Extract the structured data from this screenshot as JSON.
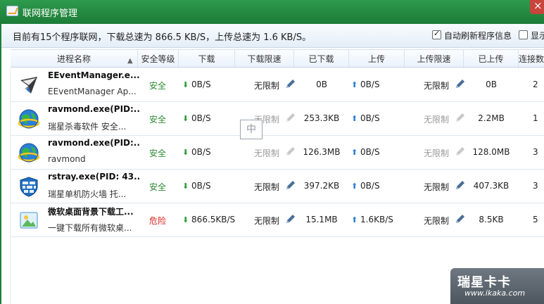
{
  "window": {
    "title": "联网程序管理"
  },
  "summary": {
    "text": "目前有15个程序联网，下载总速为  866.5 KB/S，上传总速为  1.6 KB/S。",
    "auto_refresh_label": "自动刷新程序信息",
    "auto_refresh_checked": true,
    "show_label": "显示",
    "show_checked": false
  },
  "columns": [
    "进程名称",
    "安全等级",
    "下载",
    "下载限速",
    "已下载",
    "上传",
    "上传限速",
    "已上传",
    "连接数"
  ],
  "rows": [
    {
      "icon": "eeventmanager-icon",
      "name": "EEventManager.e...",
      "desc": "EEventManager Ap...",
      "safety": "安全",
      "safety_level": "safe",
      "down": "0B/S",
      "down_limit": "无限制",
      "downloaded": "0B",
      "up": "0B/S",
      "up_limit": "无限制",
      "uploaded": "0B",
      "connections": "2"
    },
    {
      "icon": "ravmond-globe-icon",
      "name": "ravmond.exe(PID:...",
      "desc": "瑞星杀毒软件 安全...",
      "safety": "安全",
      "safety_level": "safe",
      "down": "0B/S",
      "down_limit": "无限制",
      "downloaded": "253.3KB",
      "up": "0B/S",
      "up_limit": "无限制",
      "uploaded": "2.2MB",
      "connections": "1"
    },
    {
      "icon": "ravmond-globe-icon",
      "name": "ravmond.exe(PID:...",
      "desc": "ravmond",
      "safety": "安全",
      "safety_level": "safe",
      "down": "0B/S",
      "down_limit": "无限制",
      "downloaded": "126.3MB",
      "up": "0B/S",
      "up_limit": "无限制",
      "uploaded": "128.0MB",
      "connections": "3"
    },
    {
      "icon": "firewall-shield-icon",
      "name": "rstray.exe(PID: 43...",
      "desc": "瑞星单机防火墙 托...",
      "safety": "安全",
      "safety_level": "safe",
      "down": "0B/S",
      "down_limit": "无限制",
      "downloaded": "397.2KB",
      "up": "0B/S",
      "up_limit": "无限制",
      "uploaded": "407.3KB",
      "connections": "3"
    },
    {
      "icon": "wallpaper-downloader-icon",
      "name": "微软桌面背景下载工...",
      "desc": "一键下载所有微软桌...",
      "safety": "危险",
      "safety_level": "danger",
      "down": "866.5KB/S",
      "down_limit": "无限制",
      "downloaded": "15.1MB",
      "up": "1.6KB/S",
      "up_limit": "无限制",
      "uploaded": "8.5KB",
      "connections": "5"
    }
  ],
  "ime_indicator": "中",
  "watermark": {
    "brand": "瑞星卡卡",
    "url": "www.ikaka.com"
  },
  "colors": {
    "titlebar": "#1c7c38",
    "safe": "#2a8a32",
    "danger": "#d7221b",
    "download_arrow": "#2e9e36",
    "upload_arrow": "#2f7fd0"
  }
}
